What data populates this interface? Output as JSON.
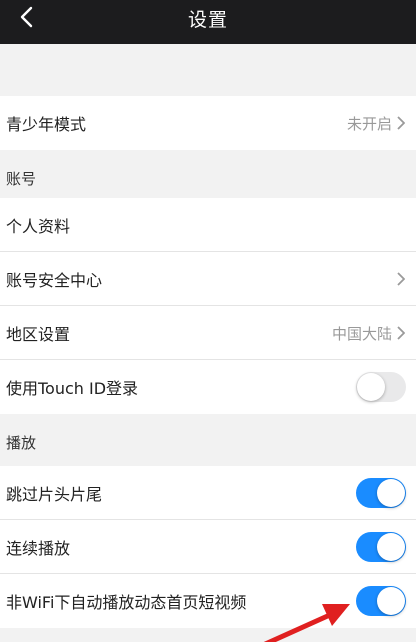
{
  "navbar": {
    "title": "设置"
  },
  "teen_mode": {
    "label": "青少年模式",
    "value": "未开启"
  },
  "account_section": {
    "header": "账号",
    "items": [
      {
        "label": "个人资料"
      },
      {
        "label": "账号安全中心"
      },
      {
        "label": "地区设置",
        "value": "中国大陆"
      },
      {
        "label": "使用Touch ID登录",
        "toggle_on": false
      }
    ]
  },
  "play_section": {
    "header": "播放",
    "items": [
      {
        "label": "跳过片头片尾",
        "toggle_on": true
      },
      {
        "label": "连续播放",
        "toggle_on": true
      },
      {
        "label": "非WiFi下自动播放动态首页短视频",
        "toggle_on": true
      }
    ]
  },
  "colors": {
    "navbar_bg": "#1c1c1e",
    "toggle_on": "#1a8cff",
    "annotation_arrow": "#e02020"
  },
  "icons": [
    "back-arrow-icon",
    "chevron-right-icon",
    "annotation-arrow-icon"
  ]
}
